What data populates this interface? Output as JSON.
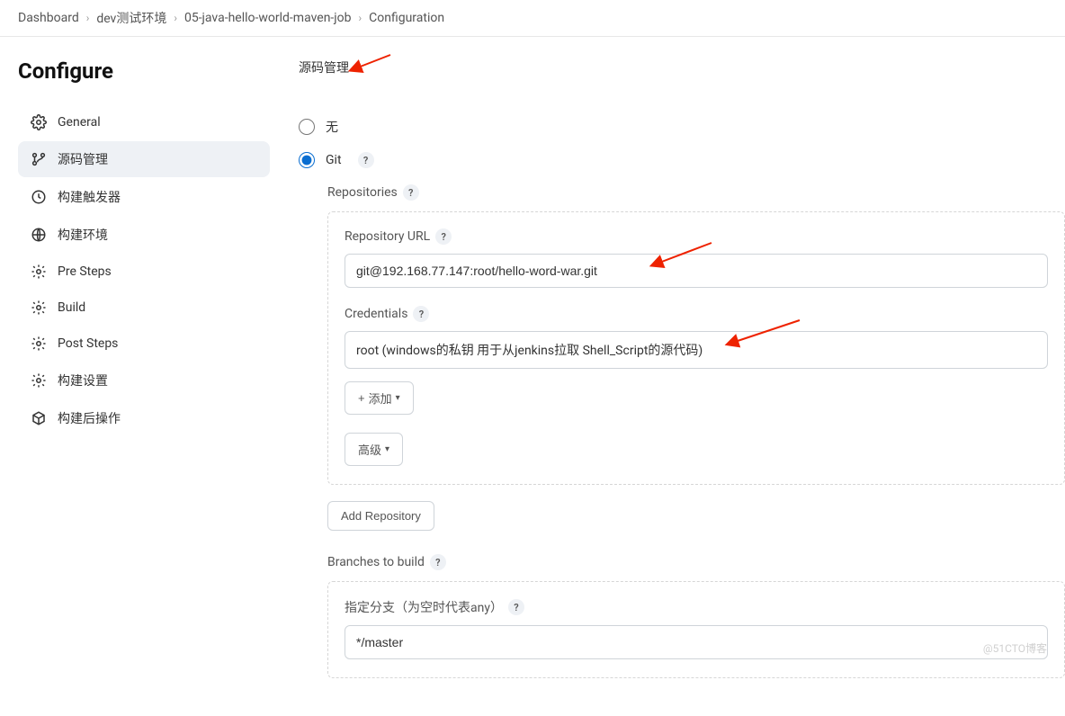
{
  "breadcrumb": [
    "Dashboard",
    "dev测试环境",
    "05-java-hello-world-maven-job",
    "Configuration"
  ],
  "page_title": "Configure",
  "sidebar": {
    "items": [
      {
        "label": "General"
      },
      {
        "label": "源码管理"
      },
      {
        "label": "构建触发器"
      },
      {
        "label": "构建环境"
      },
      {
        "label": "Pre Steps"
      },
      {
        "label": "Build"
      },
      {
        "label": "Post Steps"
      },
      {
        "label": "构建设置"
      },
      {
        "label": "构建后操作"
      }
    ]
  },
  "scm": {
    "title": "源码管理",
    "none_label": "无",
    "git_label": "Git",
    "repositories_label": "Repositories",
    "repo_url_label": "Repository URL",
    "repo_url_value": "git@192.168.77.147:root/hello-word-war.git",
    "credentials_label": "Credentials",
    "credentials_value": "root (windows的私钥 用于从jenkins拉取 Shell_Script的源代码)",
    "add_label": "添加",
    "advanced_label": "高级",
    "add_repo_label": "Add Repository",
    "branches_label": "Branches to build",
    "branch_spec_label": "指定分支（为空时代表any）",
    "branch_spec_value": "*/master"
  },
  "watermark": "@51CTO博客"
}
